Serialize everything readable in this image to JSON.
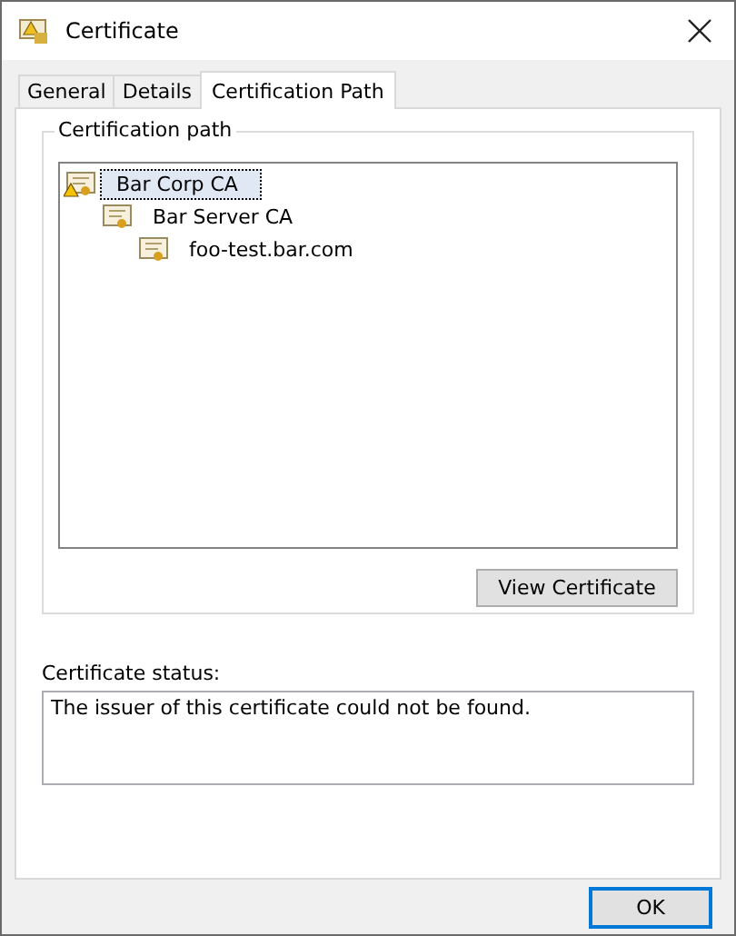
{
  "window": {
    "title": "Certificate"
  },
  "tabs": [
    {
      "label": "General",
      "selected": false
    },
    {
      "label": "Details",
      "selected": false
    },
    {
      "label": "Certification Path",
      "selected": true
    }
  ],
  "certification_path": {
    "label": "Certification path",
    "tree": [
      {
        "label": "Bar Corp CA",
        "selected": true,
        "warning": true,
        "children": [
          {
            "label": "Bar Server CA",
            "selected": false,
            "warning": false,
            "children": [
              {
                "label": "foo-test.bar.com",
                "selected": false,
                "warning": false
              }
            ]
          }
        ]
      }
    ]
  },
  "view_button": "View Certificate",
  "status": {
    "label": "Certificate status:",
    "value": "The issuer of this certificate could not be found."
  },
  "ok_button": "OK"
}
